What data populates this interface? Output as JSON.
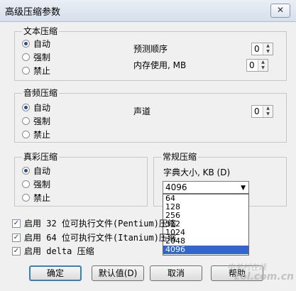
{
  "window": {
    "title": "高级压缩参数",
    "close_icon": "close-icon",
    "close_glyph": "✕"
  },
  "text_compression": {
    "title": "文本压缩",
    "options": [
      "自动",
      "强制",
      "禁止"
    ],
    "selected": "自动",
    "predict_order_label": "预测顺序",
    "predict_order_value": "0",
    "memory_label": "内存使用, MB",
    "memory_value": "0"
  },
  "audio_compression": {
    "title": "音频压缩",
    "options": [
      "自动",
      "强制",
      "禁止"
    ],
    "selected": "自动",
    "channels_label": "声道",
    "channels_value": "0"
  },
  "truecolor_compression": {
    "title": "真彩压缩",
    "options": [
      "自动",
      "强制",
      "禁止"
    ],
    "selected": "自动"
  },
  "general_compression": {
    "title": "常规压缩",
    "dict_size_label": "字典大小, KB (D)",
    "dict_size_value": "4096",
    "dict_size_options": [
      "64",
      "128",
      "256",
      "512",
      "1024",
      "2048",
      "4096"
    ],
    "dict_size_selected": "4096"
  },
  "checkboxes": [
    {
      "label": "启用 32 位可执行文件(Pentium)压缩",
      "checked": true
    },
    {
      "label": "启用 64 位可执行文件(Itanium)压缩",
      "checked": true
    },
    {
      "label": "启用 delta 压缩",
      "checked": true
    }
  ],
  "buttons": {
    "ok": "确定",
    "default": "默认值(D)",
    "cancel": "取消",
    "help": "帮助"
  },
  "watermark": {
    "line1": "中关村在线",
    "line2": "zol.com.cn"
  },
  "glyphs": {
    "check": "✓",
    "spin_up": "▲",
    "spin_down": "▼",
    "combo_arrow": "▼"
  }
}
